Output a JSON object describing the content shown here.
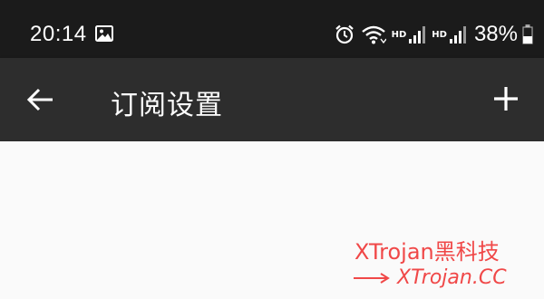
{
  "status_bar": {
    "time": "20:14",
    "icons": [
      "gallery-icon",
      "alarm-icon",
      "wifi-icon",
      "signal-icon",
      "signal-icon",
      "battery-icon"
    ],
    "hd_label_1": "HD",
    "hd_label_2": "HD",
    "battery_percent": "38%",
    "background": "#1b1b1b"
  },
  "app_bar": {
    "title": "订阅设置",
    "back_icon": "arrow-left-icon",
    "action_icon": "plus-icon",
    "background": "#2d2d2d"
  },
  "watermark": {
    "line1": "XTrojan黑科技",
    "line2": "XTrojan.CC",
    "arrow_icon": "arrow-right-icon",
    "color": "#f04848"
  }
}
